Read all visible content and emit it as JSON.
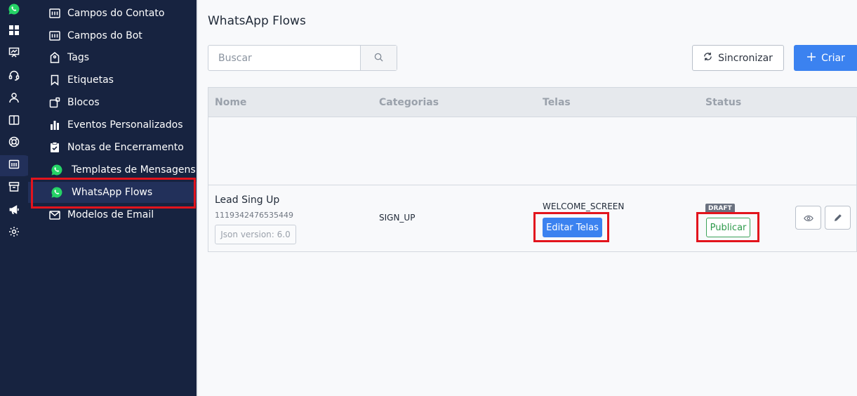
{
  "page": {
    "title": "WhatsApp Flows"
  },
  "search": {
    "placeholder": "Buscar"
  },
  "toolbar": {
    "sync_label": "Sincronizar",
    "create_label": "Criar"
  },
  "rail": {
    "icons": [
      "whatsapp-icon",
      "dashboard-icon",
      "presentation-icon",
      "headset-icon",
      "user-icon",
      "book-icon",
      "lifebuoy-icon",
      "chart-panel-icon",
      "archive-icon",
      "megaphone-icon",
      "gear-icon"
    ],
    "active_index": 7
  },
  "submenu": {
    "items": [
      {
        "label": "Campos do Contato",
        "icon": "list-panel-icon"
      },
      {
        "label": "Campos do Bot",
        "icon": "list-panel-icon"
      },
      {
        "label": "Tags",
        "icon": "tag-icon"
      },
      {
        "label": "Etiquetas",
        "icon": "bookmark-icon"
      },
      {
        "label": "Blocos",
        "icon": "blocks-icon"
      },
      {
        "label": "Eventos Personalizados",
        "icon": "bar-chart-icon"
      },
      {
        "label": "Notas de Encerramento",
        "icon": "clipboard-check-icon"
      },
      {
        "label": "Templates de Mensagens",
        "icon": "whatsapp-icon"
      },
      {
        "label": "WhatsApp Flows",
        "icon": "whatsapp-icon",
        "active": true
      },
      {
        "label": "Modelos de Email",
        "icon": "mail-icon"
      }
    ]
  },
  "table": {
    "headers": [
      "Nome",
      "Categorias",
      "Telas",
      "Status"
    ],
    "rows": [
      {
        "name": "Lead Sing Up",
        "id": "1119342476535449",
        "json_version": "Json version: 6.0",
        "category": "SIGN_UP",
        "screen": "WELCOME_SCREEN",
        "edit_label": "Editar Telas",
        "status_badge": "DRAFT",
        "publish_label": "Publicar"
      }
    ]
  },
  "colors": {
    "sidebar_bg": "#172340",
    "sidebar_active": "#22305a",
    "primary": "#3b82f0",
    "success": "#2e9a4b",
    "highlight": "#e2141d",
    "whatsapp": "#25d366"
  }
}
